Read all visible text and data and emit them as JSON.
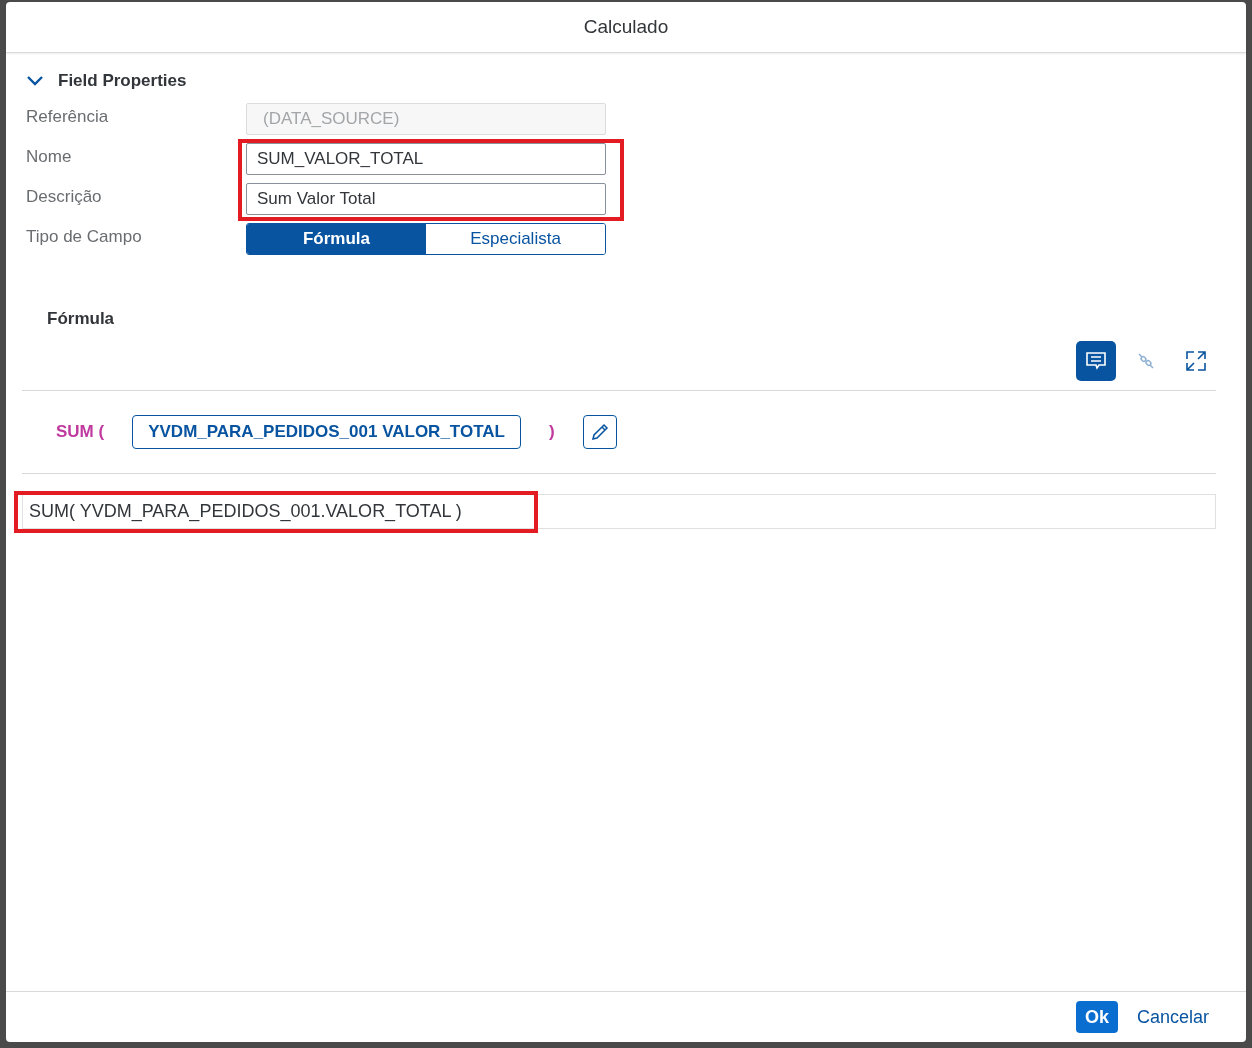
{
  "dialog": {
    "title": "Calculado"
  },
  "section": {
    "title": "Field Properties",
    "expanded": true
  },
  "fields": [
    {
      "label": "Referência",
      "kind": "input",
      "placeholder": "(DATA_SOURCE)",
      "disabled": true
    },
    {
      "label": "Nome",
      "kind": "input",
      "value": "SUM_VALOR_TOTAL",
      "disabled": false
    },
    {
      "label": "Descrição",
      "kind": "input",
      "value": "Sum Valor Total",
      "disabled": false
    },
    {
      "label": "Tipo de Campo",
      "kind": "segmented",
      "options": [
        {
          "label": "Fórmula",
          "selected": true
        },
        {
          "label": "Especialista",
          "selected": false
        }
      ]
    }
  ],
  "formula": {
    "heading": "Fórmula",
    "tools": [
      {
        "kind": "comment",
        "selected": true,
        "disabled": false
      },
      {
        "kind": "link",
        "selected": false,
        "disabled": true
      },
      {
        "kind": "expand",
        "selected": false,
        "disabled": false
      }
    ],
    "tokens": [
      {
        "kind": "function",
        "text": "SUM ("
      },
      {
        "kind": "field",
        "text": "YVDM_PARA_PEDIDOS_001 VALOR_TOTAL"
      },
      {
        "kind": "function",
        "text": ")"
      },
      {
        "kind": "edit"
      }
    ],
    "expression": "SUM( YVDM_PARA_PEDIDOS_001.VALOR_TOTAL )"
  },
  "footer": {
    "buttons": [
      {
        "label": "Ok",
        "kind": "emphasized"
      },
      {
        "label": "Cancelar",
        "kind": "transparent"
      }
    ]
  }
}
